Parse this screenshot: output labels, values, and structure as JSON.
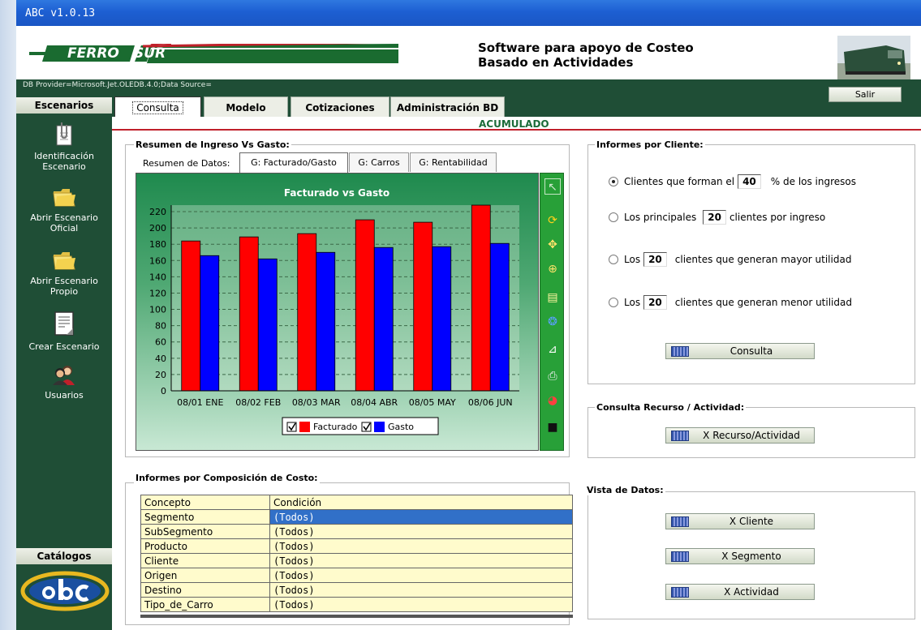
{
  "window": {
    "title": "ABC  v1.0.13"
  },
  "header": {
    "logo_left": "FERRO",
    "logo_right": "SUR",
    "title_line1": "Software para apoyo de Costeo",
    "title_line2": "Basado en Actividades",
    "provider": "DB Provider=Microsoft.Jet.OLEDB.4.0;Data Source=",
    "exit_label": "Salir"
  },
  "tabs": [
    {
      "label": "Consulta",
      "active": true
    },
    {
      "label": "Modelo",
      "active": false
    },
    {
      "label": "Cotizaciones",
      "active": false
    },
    {
      "label": "Administración BD",
      "active": false
    }
  ],
  "section_label": "ACUMULADO",
  "sidebar": {
    "header": "Escenarios",
    "items": [
      {
        "label": "Identificación Escenario",
        "icon": "paperclip-document-icon"
      },
      {
        "label": "Abrir Escenario Oficial",
        "icon": "folder-icon"
      },
      {
        "label": "Abrir Escenario Propio",
        "icon": "folder-icon"
      },
      {
        "label": "Crear Escenario",
        "icon": "new-document-icon"
      },
      {
        "label": "Usuarios",
        "icon": "users-icon"
      }
    ],
    "catalogs_header": "Catálogos",
    "brand": "abc"
  },
  "summary": {
    "title": "Resumen de Ingreso Vs Gasto:",
    "subtab_label": "Resumen de Datos:",
    "subtabs": [
      {
        "label": "G: Facturado/Gasto",
        "active": true
      },
      {
        "label": "G: Carros",
        "active": false
      },
      {
        "label": "G: Rentabilidad",
        "active": false
      }
    ]
  },
  "chart_data": {
    "type": "bar",
    "title": "Facturado vs Gasto",
    "categories": [
      "08/01 ENE",
      "08/02 FEB",
      "08/03 MAR",
      "08/04 ABR",
      "08/05 MAY",
      "08/06 JUN"
    ],
    "series": [
      {
        "name": "Facturado",
        "color": "#ff0000",
        "values": [
          184,
          189,
          193,
          210,
          207,
          228
        ]
      },
      {
        "name": "Gasto",
        "color": "#0000ff",
        "values": [
          166,
          162,
          170,
          176,
          177,
          181
        ]
      }
    ],
    "ylim": [
      0,
      228
    ],
    "yticks": [
      0,
      20,
      40,
      60,
      80,
      100,
      120,
      140,
      160,
      180,
      200,
      220
    ],
    "grid": true,
    "legend_position": "bottom-center"
  },
  "toolbar_icons": [
    "pointer-icon",
    "refresh-icon",
    "move-icon",
    "zoom-icon",
    "copy-icon",
    "palette-icon",
    "axis-icon",
    "print-icon",
    "chart-type-icon",
    "save-icon"
  ],
  "clients": {
    "title": "Informes por Cliente:",
    "opt1_pre": "Clientes que forman el",
    "opt1_val": "40",
    "opt1_post": "% de los ingresos",
    "opt2_pre": "Los principales",
    "opt2_val": "20",
    "opt2_post": "clientes por ingreso",
    "opt3_pre": "Los",
    "opt3_val": "20",
    "opt3_post": "clientes que generan mayor utilidad",
    "opt4_pre": "Los",
    "opt4_val": "20",
    "opt4_post": "clientes que generan menor utilidad",
    "button": "Consulta"
  },
  "resource": {
    "title": "Consulta  Recurso / Actividad:",
    "button": "X Recurso/Actividad"
  },
  "data_view": {
    "title": "Vista de Datos:",
    "buttons": [
      "X Cliente",
      "X Segmento",
      "X Actividad"
    ]
  },
  "cost": {
    "title": "Informes por Composición de Costo:",
    "headers": [
      "Concepto",
      "Condición"
    ],
    "rows": [
      [
        "Segmento",
        "(Todos)"
      ],
      [
        "SubSegmento",
        "(Todos)"
      ],
      [
        "Producto",
        "(Todos)"
      ],
      [
        "Cliente",
        "(Todos)"
      ],
      [
        "Origen",
        "(Todos)"
      ],
      [
        "Destino",
        "(Todos)"
      ],
      [
        "Tipo_de_Carro",
        "(Todos)"
      ]
    ]
  }
}
